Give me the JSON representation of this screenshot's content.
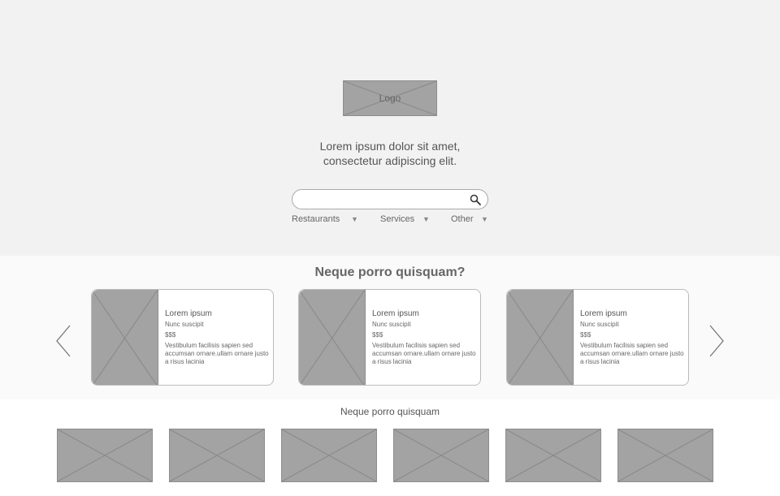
{
  "hero": {
    "logo_text": "Logo",
    "tagline_line1": "Lorem ipsum dolor sit amet,",
    "tagline_line2": "consectetur adipiscing elit.",
    "search": {
      "value": "",
      "placeholder": ""
    },
    "filters": [
      {
        "label": "Restaurants"
      },
      {
        "label": "Services"
      },
      {
        "label": "Other"
      }
    ]
  },
  "featured": {
    "title": "Neque porro quisquam?",
    "cards": [
      {
        "title": "Lorem ipsum",
        "subtitle": "Nunc suscipit",
        "price": "$$$",
        "description": "Vestibulum facilisis sapien sed accumsan ornare.ullam ornare justo a risus lacinia"
      },
      {
        "title": "Lorem ipsum",
        "subtitle": "Nunc suscipit",
        "price": "$$$",
        "description": "Vestibulum facilisis sapien sed accumsan ornare.ullam ornare justo a risus lacinia"
      },
      {
        "title": "Lorem ipsum",
        "subtitle": "Nunc suscipit",
        "price": "$$$",
        "description": "Vestibulum facilisis sapien sed accumsan ornare.ullam ornare justo a risus lacinia"
      }
    ],
    "prev_icon": "chevron-left-icon",
    "next_icon": "chevron-right-icon"
  },
  "gallery": {
    "title": "Neque porro quisquam",
    "tile_count": 6
  },
  "colors": {
    "hero_bg": "#f2f2f2",
    "placeholder": "#a3a3a3",
    "text": "#555555"
  }
}
